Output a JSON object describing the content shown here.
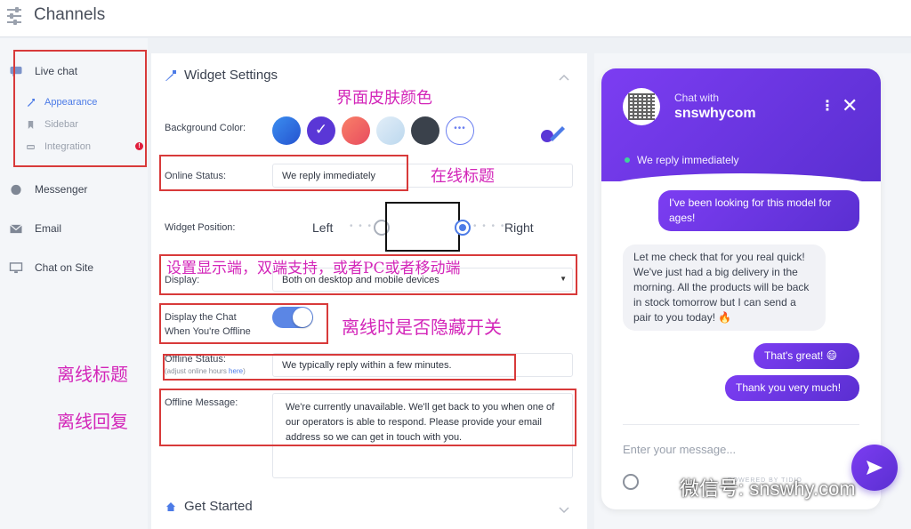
{
  "topbar": {
    "title": "Channels"
  },
  "sidebar": {
    "live_chat": "Live chat",
    "sub_items": [
      "Appearance",
      "Sidebar",
      "Integration"
    ],
    "badge": "!",
    "items": [
      "Messenger",
      "Email",
      "Chat on Site"
    ]
  },
  "settings": {
    "widget_title": "Widget Settings",
    "background_label": "Background Color:",
    "online_status_label": "Online Status:",
    "online_status_value": "We reply immediately",
    "widget_position_label": "Widget Position:",
    "left_label": "Left",
    "right_label": "Right",
    "display_label": "Display:",
    "display_value": "Both on desktop and mobile devices",
    "offline_toggle_label_1": "Display the Chat",
    "offline_toggle_label_2": "When You're Offline",
    "offline_status_label": "Offline Status:",
    "offline_status_sub_1": "(adjust online hours ",
    "offline_status_sub_link": "here",
    "offline_status_sub_2": ")",
    "offline_status_value": "We typically reply within a few minutes.",
    "offline_message_label": "Offline Message:",
    "offline_message_value": "We're currently unavailable. We'll get back to you when one of our operators is able to respond. Please provide your email address so we can get in touch with you.",
    "get_started_title": "Get Started",
    "toggle_on": true
  },
  "annotations": {
    "skin_color": "界面皮肤颜色",
    "online_title": "在线标题",
    "display_note": "设置显示端，双端支持，或者PC或者移动端",
    "offline_hide": "离线时是否隐藏开关",
    "offline_title": "离线标题",
    "offline_reply": "离线回复"
  },
  "chat": {
    "chat_with": "Chat with",
    "name": "snswhycom",
    "online_text": "We reply immediately",
    "messages": [
      "I've been looking for this model for ages!",
      "Let me check that for you real quick! We've just had a big delivery in the morning. All the products will be back in stock tomorrow but I can send a pair to you today! 🔥",
      "That's great! 😄",
      "Thank you very much!"
    ],
    "input_placeholder": "Enter your message...",
    "powered": "POWERED BY TIDIO"
  },
  "watermark": "微信号: snswhy.com",
  "colors": {
    "accent": "#4c7be7",
    "chat_purple": "#6a34e4",
    "annotation": "#d326b9",
    "highlight_box": "#d83a3a",
    "swatches": [
      "#2f6de0",
      "#5a37d6",
      "#f06a5e",
      "#cfe3f2",
      "#3a414b"
    ]
  }
}
